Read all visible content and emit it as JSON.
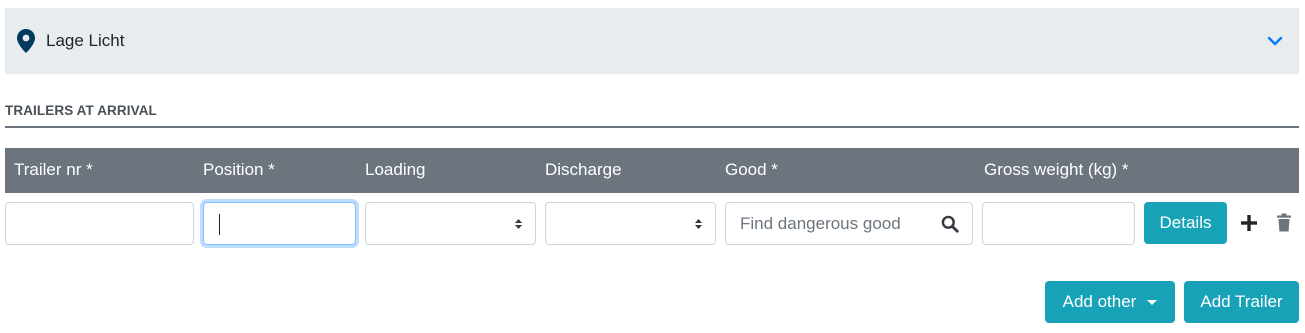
{
  "location": {
    "name": "Lage Licht",
    "pin_icon": "map-pin-icon",
    "toggle_icon": "chevron-down-icon"
  },
  "section": {
    "title": "TRAILERS AT ARRIVAL"
  },
  "table": {
    "headers": [
      "Trailer nr *",
      "Position *",
      "Loading",
      "Discharge",
      "Good *",
      "Gross weight (kg) *"
    ]
  },
  "row": {
    "trailer_nr": "",
    "position": "",
    "loading": "",
    "discharge": "",
    "good_placeholder": "Find dangerous good",
    "gross_weight": "",
    "details_label": "Details",
    "add_icon": "plus-icon",
    "delete_icon": "trash-icon"
  },
  "actions": {
    "add_other_label": "Add other",
    "add_trailer_label": "Add Trailer"
  },
  "colors": {
    "accent": "#17a2b8",
    "header_bg": "#6c757d",
    "location_bg": "#e9ecef",
    "chevron": "#007bff",
    "pin": "#003a5d"
  }
}
